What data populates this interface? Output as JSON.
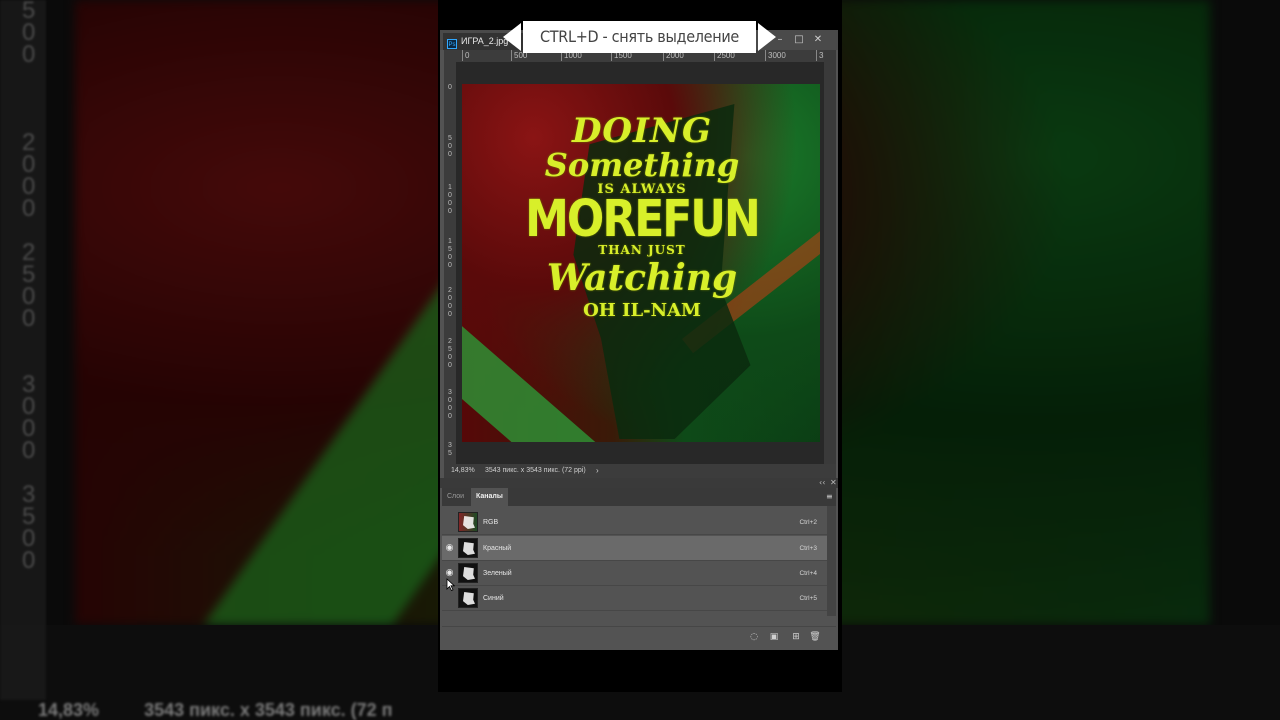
{
  "background": {
    "ruler_digits": [
      "5",
      "0",
      "0",
      "",
      "",
      "",
      "2",
      "0",
      "0",
      "0",
      "",
      "2",
      "5",
      "0",
      "0",
      "",
      "",
      "3",
      "0",
      "0",
      "0",
      "",
      "3",
      "5",
      "0",
      "0"
    ],
    "status_zoom": "14,83%",
    "status_size": "3543 пикс. x 3543 пикс. (72 п"
  },
  "window": {
    "doc_tab": "ИГРА_2.jpg @",
    "app_icon": "Ps",
    "buttons": {
      "minimize": "–",
      "maximize": "□",
      "close": "✕"
    }
  },
  "banner": {
    "text": "CTRL+D - снять выделение",
    "color": "#ffffff"
  },
  "ruler_top": [
    "0",
    "500",
    "1000",
    "1500",
    "2000",
    "2500",
    "3000",
    "35"
  ],
  "ruler_left": [
    "0",
    "5\n0\n0",
    "1\n0\n0\n0",
    "1\n5\n0\n0",
    "2\n0\n0\n0",
    "2\n5\n0\n0",
    "3\n0\n0\n0",
    "3\n5"
  ],
  "artwork": {
    "lines": [
      "DOING",
      "Something",
      "IS ALWAYS",
      "MOREFUN",
      "THAN JUST",
      "Watching",
      "OH IL-NAM"
    ],
    "text_color": "#d8ef2a"
  },
  "status": {
    "zoom": "14,83%",
    "size": "3543 пикс. x 3543 пикс. (72 ppi)",
    "arrow": "›"
  },
  "panel": {
    "collapse_icon": "‹‹",
    "close_icon": "✕",
    "tabs": [
      {
        "label": "Слои",
        "active": false
      },
      {
        "label": "Каналы",
        "active": true
      }
    ],
    "menu_icon": "≡",
    "channels": [
      {
        "name": "RGB",
        "shortcut": "Ctrl+2",
        "visible": false,
        "selected": false
      },
      {
        "name": "Красный",
        "shortcut": "Ctrl+3",
        "visible": true,
        "selected": true
      },
      {
        "name": "Зеленый",
        "shortcut": "Ctrl+4",
        "visible": true,
        "selected": false
      },
      {
        "name": "Синий",
        "shortcut": "Ctrl+5",
        "visible": false,
        "selected": false
      }
    ],
    "footer_icons": [
      "load-selection-icon",
      "save-selection-icon",
      "new-channel-icon",
      "trash-icon"
    ]
  }
}
